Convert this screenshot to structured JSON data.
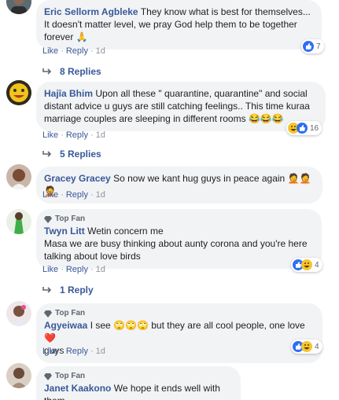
{
  "comments": [
    {
      "author": "Eric Sellorm Agbleke",
      "text": "They know what is best for themselves... It doesn't matter level, we pray God help them to be together forever",
      "trailing_emoji": "🙏",
      "like_label": "Like",
      "reply_label": "Reply",
      "time": "1d",
      "reactions": [
        "like-icon"
      ],
      "reaction_count": "7",
      "replies_label": "8 Replies"
    },
    {
      "author": "Hajīa Bhim",
      "text": "Upon all these \" quarantine, quarantine\" and social distant advice u guys are still catching feelings.. This time kuraa marriage couples are sleeping in different rooms",
      "trailing_emoji": "😂😂😂",
      "like_label": "Like",
      "reply_label": "Reply",
      "time": "1d",
      "reactions": [
        "haha-icon",
        "like-icon"
      ],
      "reaction_count": "16",
      "replies_label": "5 Replies"
    },
    {
      "author": "Gracey Gracey",
      "text": "So now we kant hug guys in peace again",
      "trailing_emoji": "🤦🤦🤦",
      "like_label": "Like",
      "reply_label": "Reply",
      "time": "1d"
    },
    {
      "badge": "Top Fan",
      "author": "Twyn Litt",
      "text_line1": "Wetin concern me",
      "text_line2": "Masa we are busy thinking about aunty corona and you're here talking about love birds",
      "like_label": "Like",
      "reply_label": "Reply",
      "time": "1d",
      "reactions": [
        "like-icon",
        "haha-icon"
      ],
      "reaction_count": "4",
      "replies_label": "1 Reply"
    },
    {
      "badge": "Top Fan",
      "author": "Agyeiwaa",
      "text_before": "I see",
      "middle_emoji": "🙄🙄🙄",
      "text_after": "but they are all cool people, one love",
      "heart_emoji": "❤️",
      "text_tail": "guys",
      "like_label": "Like",
      "reply_label": "Reply",
      "time": "1d",
      "reactions": [
        "like-icon",
        "haha-icon"
      ],
      "reaction_count": "4"
    },
    {
      "badge": "Top Fan",
      "author": "Janet Kaakono",
      "text": "We hope it ends well with them."
    }
  ],
  "colors": {
    "link": "#385898",
    "bubble": "#f2f3f5",
    "like": "#2e6ff2",
    "haha": "#f7c42c"
  }
}
